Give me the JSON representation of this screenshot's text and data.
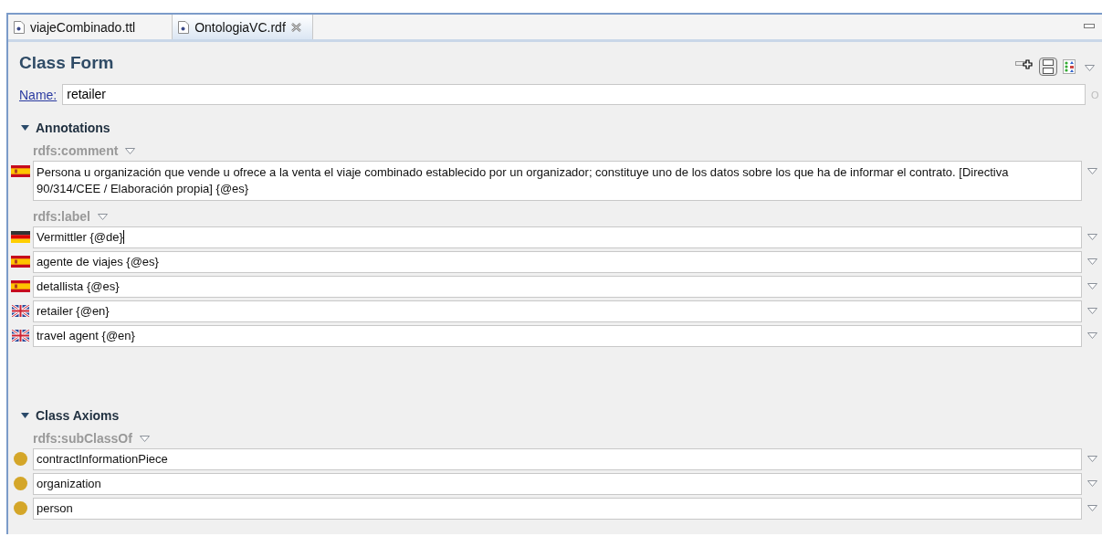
{
  "tabs": [
    {
      "label": "viajeCombinado.ttl",
      "selected": false,
      "closable": false
    },
    {
      "label": "OntologiaVC.rdf",
      "selected": true,
      "closable": true
    }
  ],
  "form": {
    "title": "Class Form",
    "name_label": "Name:",
    "name_value": "retailer",
    "ok_label": "O"
  },
  "sections": [
    {
      "title": "Annotations",
      "expanded": true,
      "groups": [
        {
          "property": "rdfs:comment",
          "rows": [
            {
              "kind": "spanish",
              "text": "Persona u organización que vende u ofrece a la venta el viaje combinado establecido por un organizador; constituye uno de los datos sobre los que ha de informar el contrato. [Directiva 90/314/CEE / Elaboración propia] {@es}",
              "multiline": true,
              "focused": false
            }
          ]
        },
        {
          "property": "rdfs:label",
          "rows": [
            {
              "kind": "german",
              "text": "Vermittler {@de}",
              "multiline": false,
              "focused": true
            },
            {
              "kind": "spanish",
              "text": "agente de viajes {@es}",
              "multiline": false,
              "focused": false
            },
            {
              "kind": "spanish",
              "text": "detallista {@es}",
              "multiline": false,
              "focused": false
            },
            {
              "kind": "english",
              "text": "retailer {@en}",
              "multiline": false,
              "focused": false
            },
            {
              "kind": "english",
              "text": "travel agent {@en}",
              "multiline": false,
              "focused": false
            }
          ]
        }
      ]
    },
    {
      "title": "Class Axioms",
      "expanded": true,
      "groups": [
        {
          "property": "rdfs:subClassOf",
          "rows": [
            {
              "kind": "class",
              "text": "contractInformationPiece",
              "multiline": false,
              "focused": false
            },
            {
              "kind": "class",
              "text": "organization",
              "multiline": false,
              "focused": false
            },
            {
              "kind": "class",
              "text": "person",
              "multiline": false,
              "focused": false
            }
          ]
        }
      ]
    }
  ]
}
